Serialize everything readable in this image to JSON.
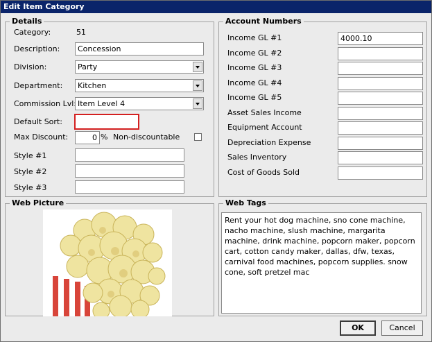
{
  "window": {
    "title": "Edit Item Category"
  },
  "details": {
    "legend": "Details",
    "category_label": "Category:",
    "category_value": "51",
    "description_label": "Description:",
    "description_value": "Concession",
    "division_label": "Division:",
    "division_value": "Party",
    "department_label": "Department:",
    "department_value": "Kitchen",
    "commission_label": "Commission Lvl:",
    "commission_value": "Item Level 4",
    "default_sort_label": "Default Sort:",
    "default_sort_value": "",
    "max_discount_label": "Max Discount:",
    "max_discount_value": "0",
    "percent_sign": "%",
    "non_discountable_label": "Non-discountable",
    "style1_label": "Style #1",
    "style2_label": "Style #2",
    "style3_label": "Style #3"
  },
  "accounts": {
    "legend": "Account Numbers",
    "rows": [
      {
        "label": "Income GL #1",
        "value": "4000.10"
      },
      {
        "label": "Income GL #2",
        "value": ""
      },
      {
        "label": "Income GL #3",
        "value": ""
      },
      {
        "label": "Income GL #4",
        "value": ""
      },
      {
        "label": "Income GL #5",
        "value": ""
      },
      {
        "label": "Asset Sales Income",
        "value": ""
      },
      {
        "label": "Equipment Account",
        "value": ""
      },
      {
        "label": "Depreciation Expense",
        "value": ""
      },
      {
        "label": "Sales Inventory",
        "value": ""
      },
      {
        "label": "Cost of Goods Sold",
        "value": ""
      }
    ]
  },
  "web_picture": {
    "legend": "Web Picture"
  },
  "web_tags": {
    "legend": "Web Tags",
    "text": "Rent your hot dog machine, sno cone machine, nacho machine, slush machine, margarita machine, drink machine, popcorn maker, popcorn cart, cotton candy maker, dallas, dfw, texas, carnival food machines, popcorn supplies. snow cone, soft pretzel mac"
  },
  "buttons": {
    "ok": "OK",
    "cancel": "Cancel"
  },
  "colors": {
    "titlebar": "#0a246a",
    "highlight": "#d42020",
    "panel": "#ebebeb"
  }
}
